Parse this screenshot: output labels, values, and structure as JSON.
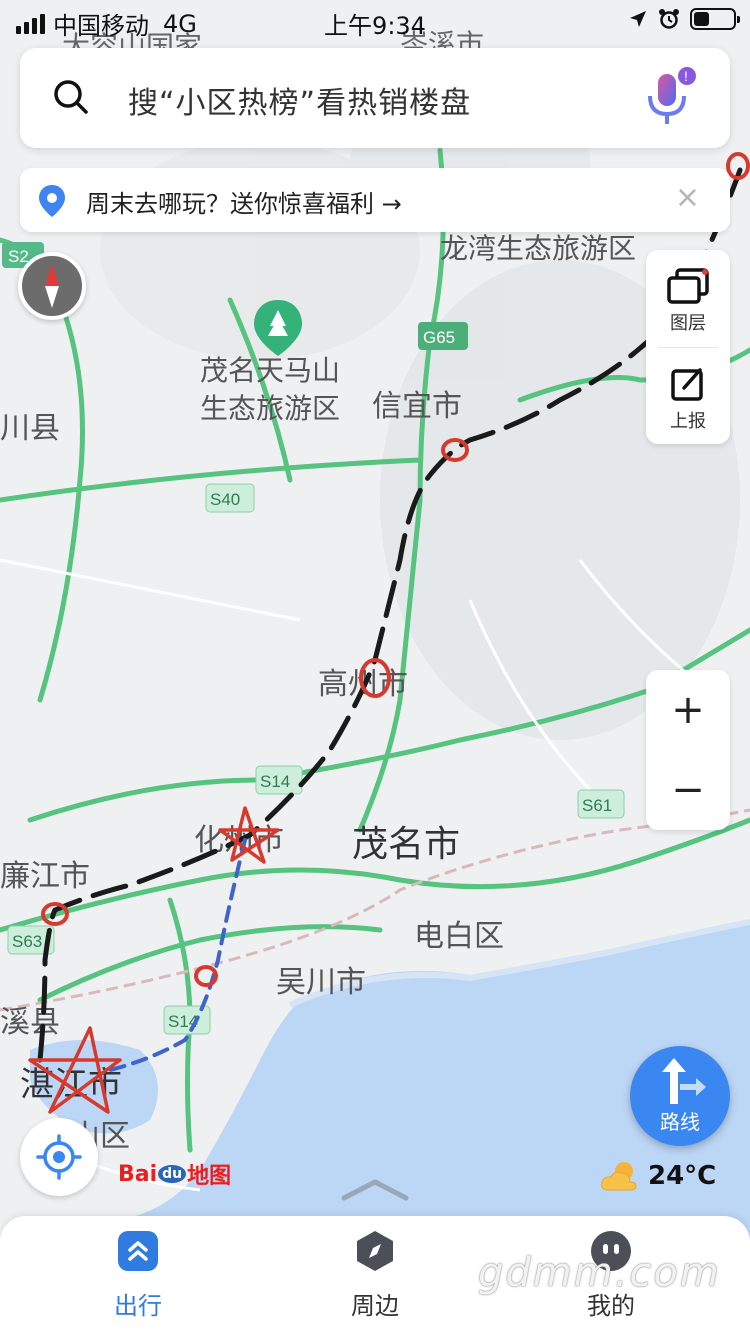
{
  "status_bar": {
    "carrier": "中国移动",
    "network": "4G",
    "time": "上午9:34"
  },
  "search": {
    "placeholder": "搜“小区热榜”看热销楼盘"
  },
  "notice": {
    "text": "周末去哪玩？送你惊喜福利 →",
    "close": "×"
  },
  "map_labels": {
    "darong": "大容山国家",
    "cenxi": "岑溪市",
    "longwan": "龙湾生态旅游区",
    "tianmashan_1": "茂名天马山",
    "tianmashan_2": "生态旅游区",
    "xinyi": "信宜市",
    "chuanxian": "川县",
    "gaozhou": "高州市",
    "huazhou": "化州市",
    "maoming": "茂名市",
    "lianjiang": "廉江市",
    "dianbai": "电白区",
    "wuchuan": "吴川市",
    "suixi": "溪县",
    "zhanjiang": "湛江市",
    "shanqu": "山区"
  },
  "road_shields": {
    "s2": "S2",
    "g65": "G65",
    "s40": "S40",
    "s14a": "S14",
    "s61": "S61",
    "s63": "S63",
    "s14b": "S14"
  },
  "side_panel": {
    "layers": "图层",
    "report": "上报"
  },
  "zoom": {
    "in": "+",
    "out": "−"
  },
  "route": {
    "label": "路线"
  },
  "logo": {
    "bai": "Bai",
    "du": "du",
    "map": "地图"
  },
  "weather": {
    "temperature": "24°C",
    "icon": "partly-cloudy-icon"
  },
  "tabs": [
    {
      "label": "出行",
      "icon": "chevron-up-double-icon",
      "active": true
    },
    {
      "label": "周边",
      "icon": "compass-icon",
      "active": false
    },
    {
      "label": "我的",
      "icon": "profile-icon",
      "active": false
    }
  ],
  "watermark": "gdmm.com",
  "colors": {
    "accent": "#3a87f2",
    "sea": "#bcd6f5",
    "road": "#56c37f",
    "annotation_red": "#d63a2f"
  }
}
